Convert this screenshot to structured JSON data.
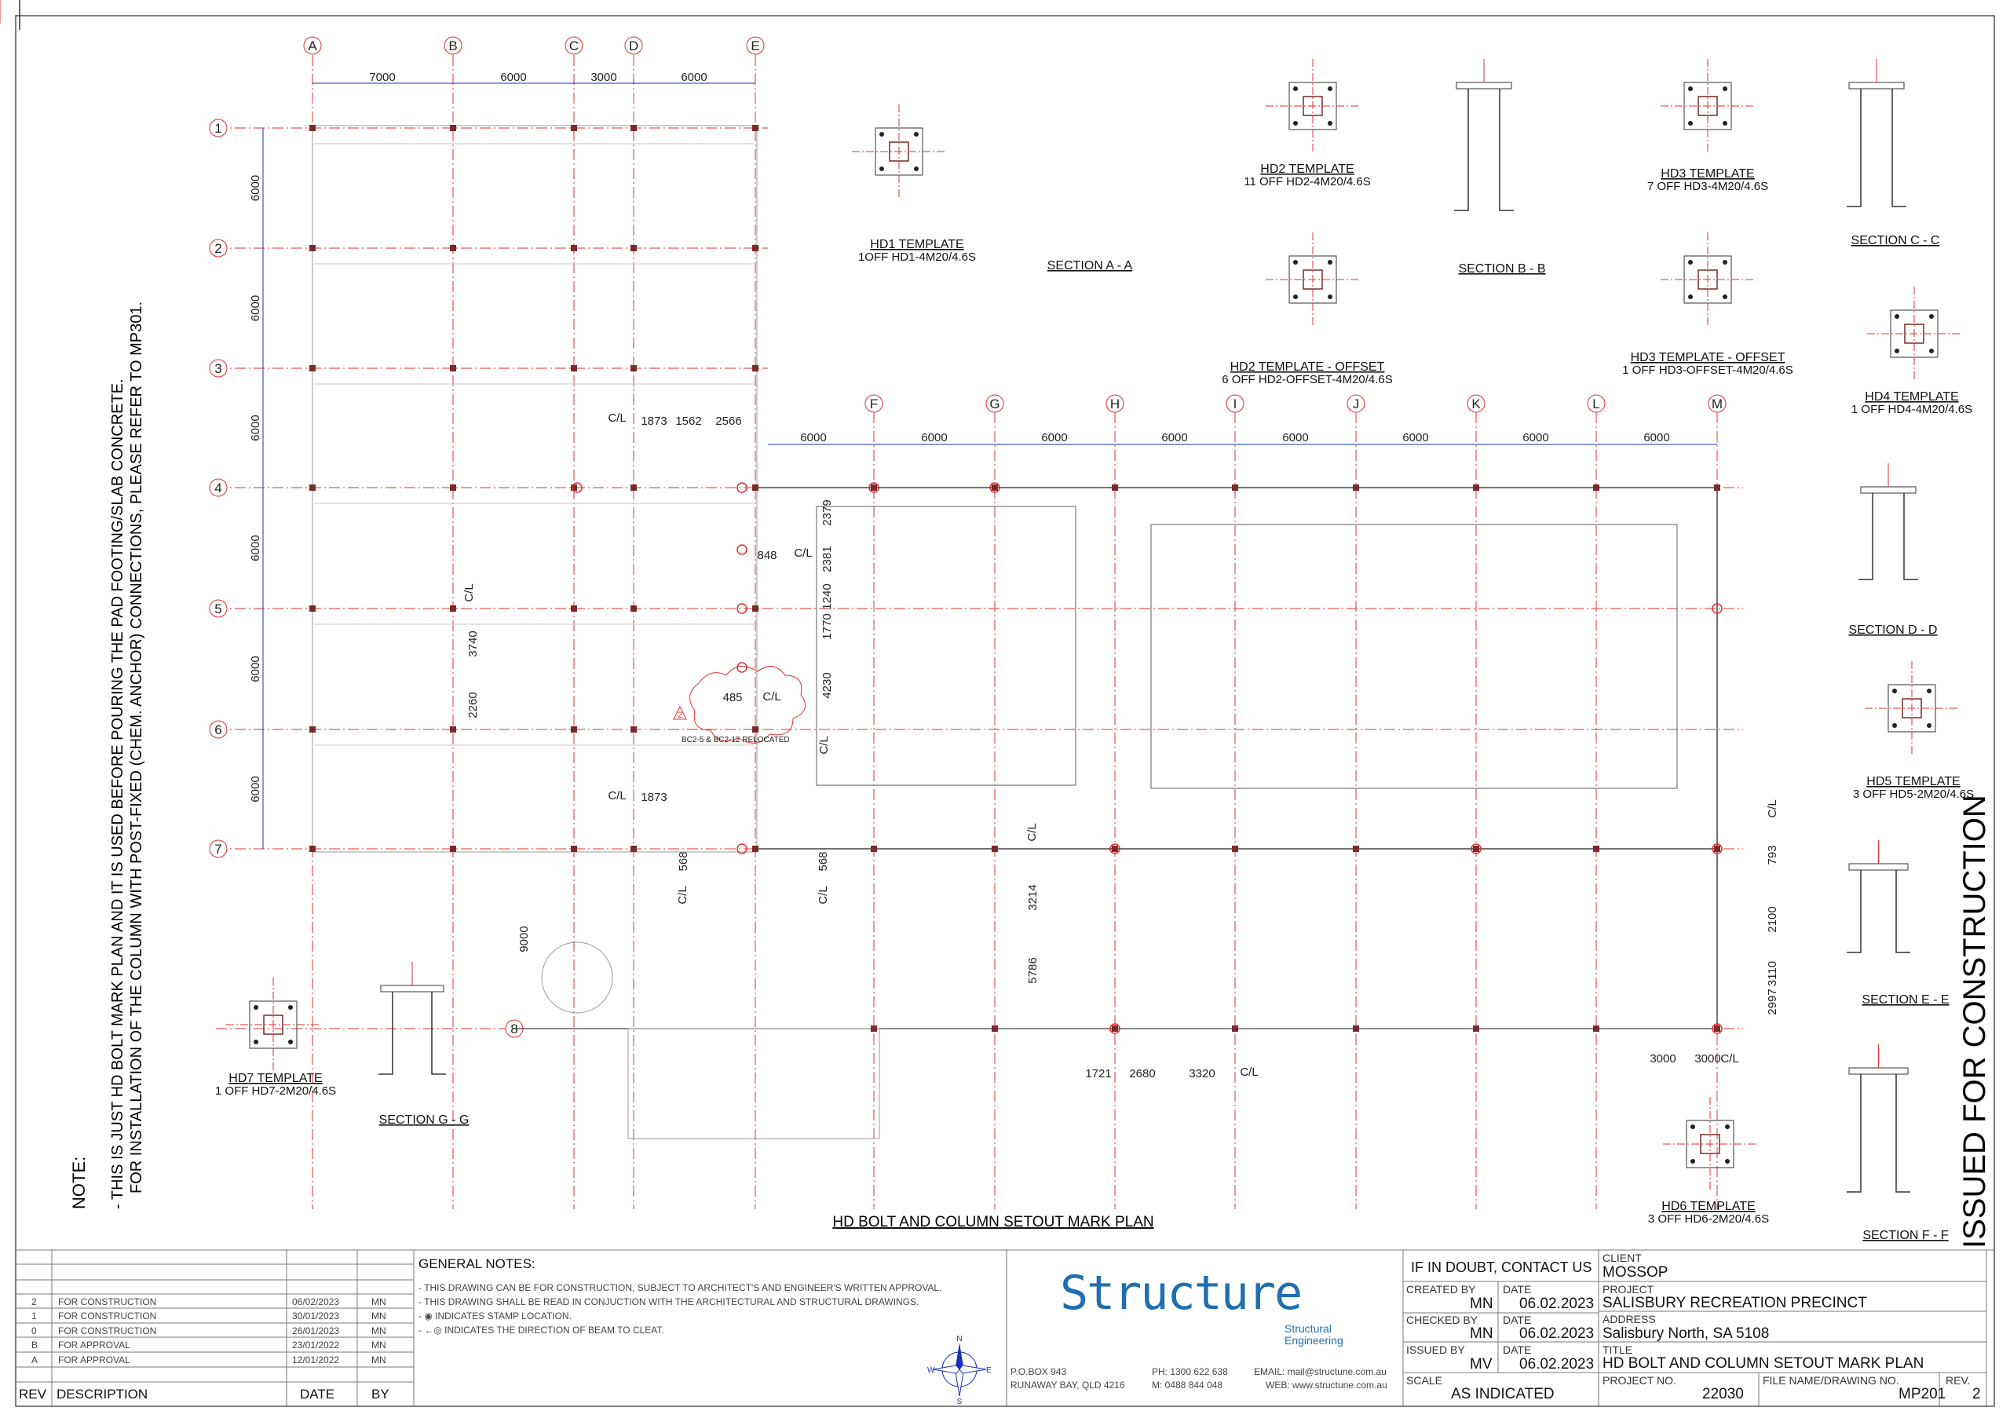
{
  "drawing": {
    "main_title": "HD BOLT AND COLUMN SETOUT MARK PLAN",
    "issued_stamp": "ISSUED FOR CONSTRUCTION",
    "note_title": "NOTE:",
    "note_line1": "- THIS IS JUST HD BOLT MARK PLAN AND IT IS USED BEFORE POURING THE PAD FOOTING/SLAB CONCRETE.",
    "note_line2": "FOR INSTALLATION OF THE COLUMN WITH POST-FIXED (CHEM. ANCHOR) CONNECTIONS, PLEASE REFER TO MP301.",
    "grid_letters_upper": [
      "A",
      "B",
      "C",
      "D",
      "E"
    ],
    "grid_letters_lower": [
      "F",
      "G",
      "H",
      "I",
      "J",
      "K",
      "L",
      "M"
    ],
    "grid_numbers": [
      "1",
      "2",
      "3",
      "4",
      "5",
      "6",
      "7",
      "8"
    ],
    "dims_top": [
      "7000",
      "6000",
      "3000",
      "6000"
    ],
    "dims_left": [
      "6000",
      "6000",
      "6000",
      "6000",
      "6000",
      "6000"
    ],
    "dims_lower": [
      "6000",
      "6000",
      "6000",
      "6000",
      "6000",
      "6000",
      "6000",
      "6000"
    ],
    "dims_misc": [
      "1873",
      "1562",
      "2566",
      "2379",
      "848",
      "2381",
      "1240",
      "1770",
      "4230",
      "485",
      "3740",
      "2260",
      "1873",
      "568",
      "568",
      "3214",
      "5786",
      "9000",
      "1721",
      "2680",
      "3320",
      "793",
      "2100",
      "3110",
      "2997",
      "3000",
      "3000"
    ],
    "cl": "C/L",
    "cloud_text": "BC2-5 & BC2-12 RELOCATED",
    "rev_marker": "2"
  },
  "details": [
    {
      "title": "HD1 TEMPLATE",
      "sub": "1OFF HD1-4M20/4.6S"
    },
    {
      "title": "SECTION  A - A",
      "sub": ""
    },
    {
      "title": "HD2 TEMPLATE",
      "sub": "11 OFF HD2-4M20/4.6S"
    },
    {
      "title": "HD2 TEMPLATE - OFFSET",
      "sub": "6 OFF HD2-OFFSET-4M20/4.6S"
    },
    {
      "title": "SECTION  B - B",
      "sub": ""
    },
    {
      "title": "HD3 TEMPLATE",
      "sub": "7 OFF HD3-4M20/4.6S"
    },
    {
      "title": "HD3 TEMPLATE - OFFSET",
      "sub": "1 OFF HD3-OFFSET-4M20/4.6S"
    },
    {
      "title": "SECTION  C - C",
      "sub": ""
    },
    {
      "title": "HD4 TEMPLATE",
      "sub": "1 OFF HD4-4M20/4.6S"
    },
    {
      "title": "SECTION  D - D",
      "sub": ""
    },
    {
      "title": "HD5 TEMPLATE",
      "sub": "3 OFF HD5-2M20/4.6S"
    },
    {
      "title": "SECTION  E - E",
      "sub": ""
    },
    {
      "title": "HD6 TEMPLATE",
      "sub": "3 OFF HD6-2M20/4.6S"
    },
    {
      "title": "SECTION  F - F",
      "sub": ""
    },
    {
      "title": "HD7 TEMPLATE",
      "sub": "1 OFF HD7-2M20/4.6S"
    },
    {
      "title": "SECTION  G - G",
      "sub": ""
    }
  ],
  "revisions": {
    "headers": [
      "REV",
      "DESCRIPTION",
      "DATE",
      "BY"
    ],
    "rows": [
      {
        "rev": "2",
        "desc": "FOR CONSTRUCTION",
        "date": "06/02/2023",
        "by": "MN"
      },
      {
        "rev": "1",
        "desc": "FOR CONSTRUCTION",
        "date": "30/01/2023",
        "by": "MN"
      },
      {
        "rev": "0",
        "desc": "FOR CONSTRUCTION",
        "date": "26/01/2023",
        "by": "MN"
      },
      {
        "rev": "B",
        "desc": "FOR APPROVAL",
        "date": "23/01/2022",
        "by": "MN"
      },
      {
        "rev": "A",
        "desc": "FOR APPROVAL",
        "date": "12/01/2022",
        "by": "MN"
      }
    ]
  },
  "general_notes": {
    "title": "GENERAL NOTES:",
    "lines": [
      "- THIS DRAWING CAN BE FOR CONSTRUCTION, SUBJECT TO ARCHITECT'S AND ENGINEER'S WRITTEN APPROVAL.",
      "- THIS DRAWING SHALL BE READ IN CONJUCTION WITH THE ARCHITECTURAL AND STRUCTURAL DRAWINGS.",
      "- ◉ INDICATES STAMP LOCATION.",
      "- ←◎ INDICATES THE DIRECTION OF BEAM TO CLEAT."
    ]
  },
  "company": {
    "logo": "Structure",
    "logo_sub": "Structural\nEngineering",
    "po_line1": "P.O.BOX 943",
    "po_line2": "RUNAWAY BAY, QLD 4216",
    "ph": "PH:  1300 622 638",
    "mob": "M:   0488 844 048",
    "email": "EMAIL: mail@structune.com.au",
    "web": "WEB: www.structune.com.au"
  },
  "titleblock": {
    "if_in_doubt": "IF IN DOUBT, CONTACT US",
    "created_by_label": "CREATED BY",
    "created_by": "MN",
    "checked_by_label": "CHECKED BY",
    "checked_by": "MN",
    "issued_by_label": "ISSUED BY",
    "issued_by": "MV",
    "date_label": "DATE",
    "date": "06.02.2023",
    "scale_label": "SCALE",
    "scale": "AS INDICATED",
    "client_label": "CLIENT",
    "client": "MOSSOP",
    "project_label": "PROJECT",
    "project": "SALISBURY RECREATION PRECINCT",
    "address_label": "ADDRESS",
    "address": "Salisbury North, SA 5108",
    "title_label": "TITLE",
    "title": "HD BOLT AND COLUMN SETOUT MARK PLAN",
    "project_no_label": "PROJECT NO.",
    "project_no": "22030",
    "drawing_no_label": "FILE NAME/DRAWING NO.",
    "drawing_no": "MP201",
    "rev_label": "REV.",
    "rev": "2"
  },
  "compass": {
    "n": "N",
    "s": "S",
    "e": "E",
    "w": "W"
  },
  "colors": {
    "grid": "#e03030",
    "bubble": "#e03030",
    "dim": "#1a2fbf",
    "line": "#222222",
    "faint": "#9a9a9a",
    "brand": "#1f6fb0"
  }
}
